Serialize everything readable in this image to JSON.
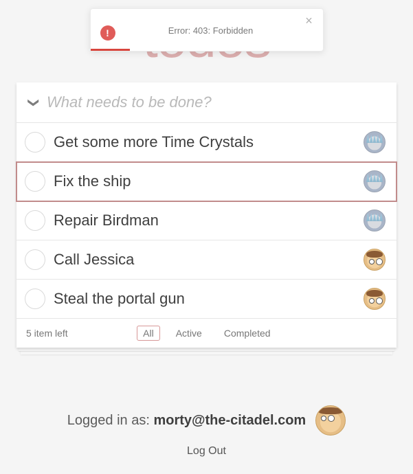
{
  "toast": {
    "message": "Error: 403: Forbidden",
    "progress_pct": 17
  },
  "app": {
    "title": "todos"
  },
  "input": {
    "placeholder": "What needs to be done?",
    "value": ""
  },
  "todos": [
    {
      "label": "Get some more Time Crystals",
      "owner": "rick",
      "highlighted": false
    },
    {
      "label": "Fix the ship",
      "owner": "rick",
      "highlighted": true
    },
    {
      "label": "Repair Birdman",
      "owner": "rick",
      "highlighted": false
    },
    {
      "label": "Call Jessica",
      "owner": "morty",
      "highlighted": false
    },
    {
      "label": "Steal the portal gun",
      "owner": "morty",
      "highlighted": false
    }
  ],
  "footer": {
    "count_text": "5 item left",
    "filters": {
      "all": "All",
      "active": "Active",
      "completed": "Completed",
      "selected": "all"
    }
  },
  "session": {
    "prefix": "Logged in as: ",
    "email": "morty@the-citadel.com",
    "logout_label": "Log Out",
    "avatar": "morty"
  }
}
